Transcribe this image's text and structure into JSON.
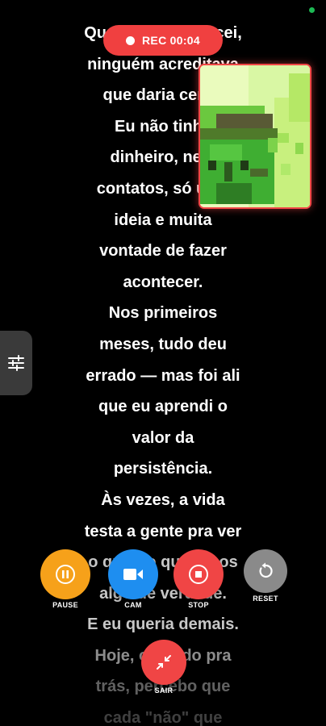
{
  "prompter": {
    "lines": [
      "Quando eu comecei,",
      "ninguém acreditava",
      "que daria certo.",
      "Eu não tinha",
      "dinheiro, nem",
      "contatos, só uma",
      "ideia e muita",
      "vontade de fazer",
      "acontecer.",
      "Nos primeiros",
      "meses, tudo deu",
      "errado — mas foi ali",
      "que eu aprendi o",
      "valor da",
      "persistência.",
      "Às vezes, a vida",
      "testa a gente pra ver",
      "o quanto queremos",
      "algo de verdade.",
      "E eu queria demais.",
      "Hoje, olhando pra",
      "trás, percebo que",
      "cada \"não\" que"
    ]
  },
  "recording": {
    "label": "REC 00:04",
    "color": "#f04040"
  },
  "controls": {
    "pause": {
      "label": "PAUSE",
      "color": "#f6a11a",
      "icon": "pause-icon"
    },
    "cam": {
      "label": "CAM",
      "color": "#1e8ef0",
      "icon": "videocam-icon"
    },
    "stop": {
      "label": "STOP",
      "color": "#f04545",
      "icon": "stop-icon"
    },
    "reset": {
      "label": "RESET",
      "color": "#8a8a8a",
      "icon": "reset-icon"
    },
    "exit": {
      "label": "SAIR",
      "color": "#f04545",
      "icon": "collapse-icon"
    }
  },
  "side_panel": {
    "icon": "sliders-icon"
  }
}
